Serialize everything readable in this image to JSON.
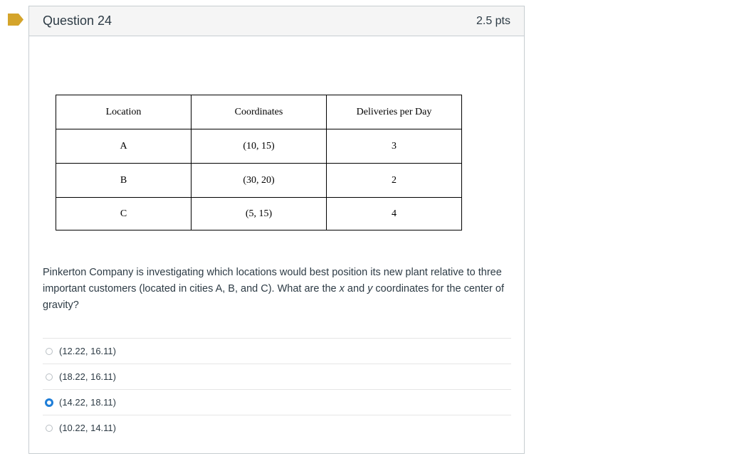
{
  "question": {
    "title": "Question 24",
    "points": "2.5 pts",
    "flag_color": "#d4a42b",
    "table": {
      "headers": [
        "Location",
        "Coordinates",
        "Deliveries per Day"
      ],
      "rows": [
        [
          "A",
          "(10, 15)",
          "3"
        ],
        [
          "B",
          "(30, 20)",
          "2"
        ],
        [
          "C",
          "(5, 15)",
          "4"
        ]
      ]
    },
    "prompt_text": "Pinkerton Company is investigating which locations would best position its new plant relative to three important customers (located in cities A, B, and C). What are the x and y coordinates for the center of gravity?",
    "answers": [
      {
        "label": "(12.22, 16.11)",
        "selected": false
      },
      {
        "label": "(18.22, 16.11)",
        "selected": false
      },
      {
        "label": "(14.22, 18.11)",
        "selected": true
      },
      {
        "label": "(10.22, 14.11)",
        "selected": false
      }
    ]
  }
}
